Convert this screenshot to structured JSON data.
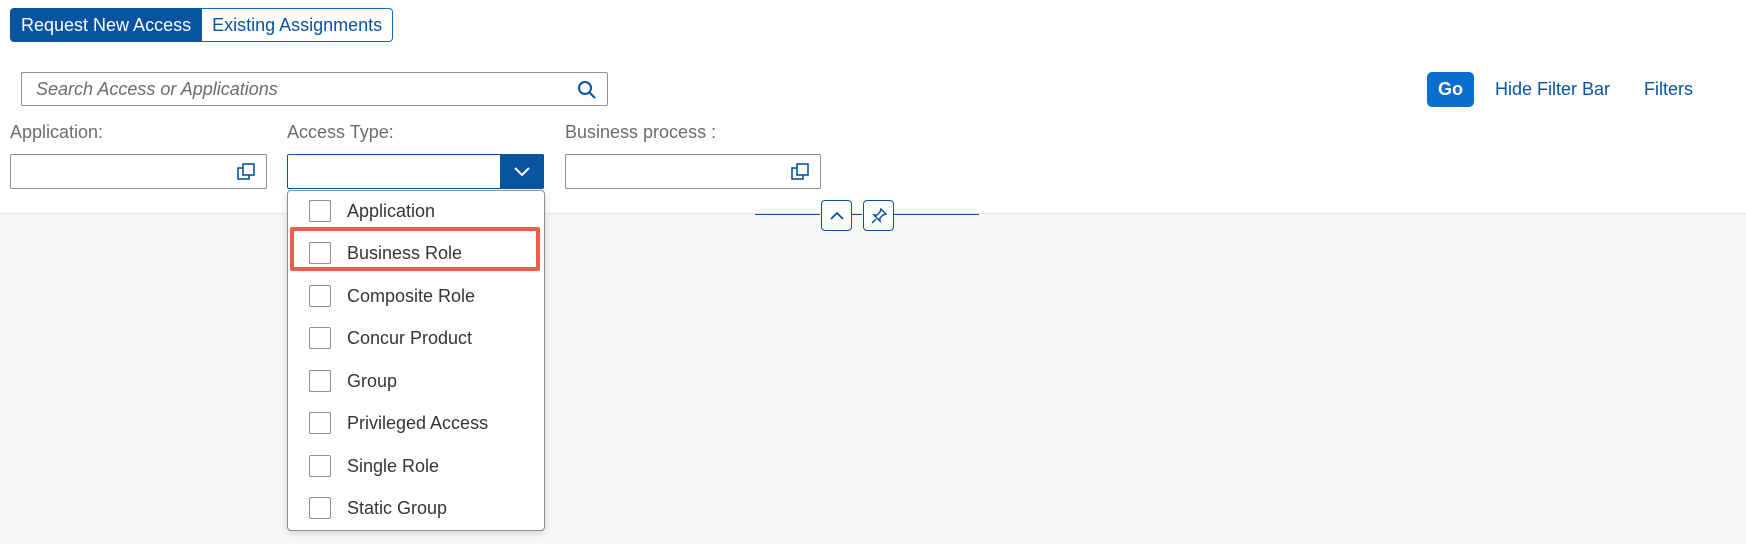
{
  "tabs": {
    "request_new_access": "Request New Access",
    "existing_assignments": "Existing Assignments"
  },
  "search": {
    "placeholder": "Search Access or Applications"
  },
  "toolbar": {
    "go": "Go",
    "hide_filter_bar": "Hide Filter Bar",
    "filters": "Filters"
  },
  "filters": {
    "application_label": "Application:",
    "access_type_label": "Access Type:",
    "business_process_label": "Business process :"
  },
  "access_type_options": [
    {
      "label": "Application",
      "checked": false
    },
    {
      "label": "Business Role",
      "checked": false,
      "highlighted": true
    },
    {
      "label": "Composite Role",
      "checked": false
    },
    {
      "label": "Concur Product",
      "checked": false
    },
    {
      "label": "Group",
      "checked": false
    },
    {
      "label": "Privileged Access",
      "checked": false
    },
    {
      "label": "Single Role",
      "checked": false
    },
    {
      "label": "Static Group",
      "checked": false
    }
  ],
  "colors": {
    "brand": "#0854a0",
    "accent": "#0a6ed1",
    "highlight": "#e8604c"
  }
}
